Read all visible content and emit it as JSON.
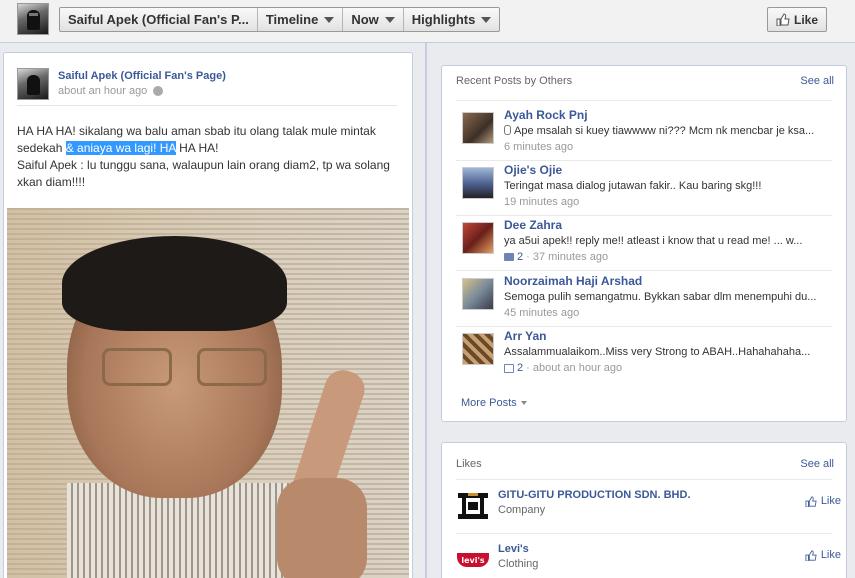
{
  "header": {
    "page_name": "Saiful Apek (Official Fan's P...",
    "nav": [
      "Timeline",
      "Now",
      "Highlights"
    ],
    "like_label": "Like"
  },
  "post": {
    "author": "Saiful Apek (Official Fan's Page)",
    "time": "about an hour ago",
    "text_part1": "HA HA HA! sikalang wa balu aman sbab itu olang talak mule mintak sedekah ",
    "text_highlight": "& aniaya wa lagi! HA",
    "text_part2": " HA HA!",
    "text_line2": "Saiful Apek : lu tunggu sana, walaupun lain orang diam2, tp wa solang xkan diam!!!!"
  },
  "recent_posts": {
    "title": "Recent Posts by Others",
    "see_all": "See all",
    "items": [
      {
        "name": "Ayah Rock Pnj",
        "text": "Ape msalah si kuey tiawwww ni??? Mcm nk mencbar je ksa...",
        "meta": "6 minutes ago",
        "count": ""
      },
      {
        "name": "Ojie's Ojie",
        "text": "Teringat masa dialog jutawan fakir.. Kau baring skg!!!",
        "meta": "19 minutes ago",
        "count": ""
      },
      {
        "name": "Dee Zahra",
        "text": "ya a5ui apek!! reply me!! atleast i know that u read me! ... w...",
        "meta": "· 37 minutes ago",
        "count": "2"
      },
      {
        "name": "Noorzaimah Haji Arshad",
        "text": "Semoga pulih semangatmu. Bykkan sabar dlm menempuhi du...",
        "meta": "45 minutes ago",
        "count": ""
      },
      {
        "name": "Arr Yan",
        "text": "Assalammualaikom..Miss very Strong to ABAH..Hahahahaha...",
        "meta": "· about an hour ago",
        "count": "2"
      }
    ],
    "more": "More Posts"
  },
  "likes": {
    "title": "Likes",
    "see_all": "See all",
    "items": [
      {
        "name": "GITU-GITU PRODUCTION SDN. BHD.",
        "category": "Company",
        "like": "Like"
      },
      {
        "name": "Levi's",
        "category": "Clothing",
        "like": "Like",
        "logo_text": "levi's"
      }
    ]
  },
  "colors": {
    "link": "#3b5998",
    "highlight": "#3399ff",
    "border": "#c4cde0"
  }
}
